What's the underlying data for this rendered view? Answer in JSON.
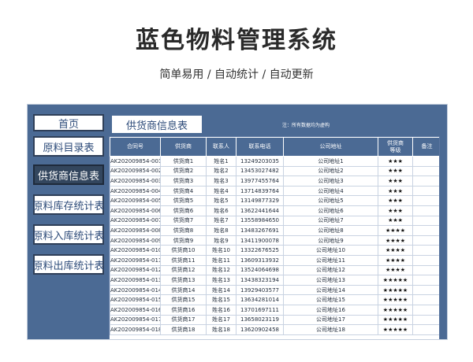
{
  "title": "蓝色物料管理系统",
  "subtitle": "简单易用  /  自动统计  /  自动更新",
  "sidebar": {
    "items": [
      {
        "label": "首页"
      },
      {
        "label": "原料目录表"
      },
      {
        "label": "供货商信息表"
      },
      {
        "label": "原料库存统计表"
      },
      {
        "label": "原料入库统计表"
      },
      {
        "label": "原料出库统计表"
      }
    ]
  },
  "main": {
    "section_title": "供货商信息表",
    "note": "注：所有数据均为虚构",
    "columns": [
      "合同号",
      "供货商",
      "联系人",
      "联系电话",
      "公司地址",
      "供货商\n等级",
      "备注"
    ],
    "rows": [
      [
        "AK202009854-001",
        "供货商1",
        "姓名1",
        "13249203035",
        "公司地址1",
        "★★★",
        ""
      ],
      [
        "AK202009854-002",
        "供货商2",
        "姓名2",
        "13453027482",
        "公司地址2",
        "★★★",
        ""
      ],
      [
        "AK202009854-003",
        "供货商3",
        "姓名3",
        "13977455764",
        "公司地址3",
        "★★★",
        ""
      ],
      [
        "AK202009854-004",
        "供货商4",
        "姓名4",
        "13714839764",
        "公司地址4",
        "★★★",
        ""
      ],
      [
        "AK202009854-005",
        "供货商5",
        "姓名5",
        "13149877329",
        "公司地址5",
        "★★★",
        ""
      ],
      [
        "AK202009854-006",
        "供货商6",
        "姓名6",
        "13622441644",
        "公司地址6",
        "★★★",
        ""
      ],
      [
        "AK202009854-007",
        "供货商7",
        "姓名7",
        "13558984650",
        "公司地址7",
        "★★★",
        ""
      ],
      [
        "AK202009854-008",
        "供货商8",
        "姓名8",
        "13483267691",
        "公司地址8",
        "★★★★",
        ""
      ],
      [
        "AK202009854-009",
        "供货商9",
        "姓名9",
        "13411900078",
        "公司地址9",
        "★★★★",
        ""
      ],
      [
        "AK202009854-010",
        "供货商10",
        "姓名10",
        "13322676525",
        "公司地址10",
        "★★★★",
        ""
      ],
      [
        "AK202009854-011",
        "供货商11",
        "姓名11",
        "13609313932",
        "公司地址11",
        "★★★★",
        ""
      ],
      [
        "AK202009854-012",
        "供货商12",
        "姓名12",
        "13524064698",
        "公司地址12",
        "★★★★",
        ""
      ],
      [
        "AK202009854-013",
        "供货商13",
        "姓名13",
        "13438323194",
        "公司地址13",
        "★★★★★",
        ""
      ],
      [
        "AK202009854-014",
        "供货商14",
        "姓名14",
        "13929403577",
        "公司地址14",
        "★★★★★",
        ""
      ],
      [
        "AK202009854-015",
        "供货商15",
        "姓名15",
        "13634281014",
        "公司地址15",
        "★★★★★",
        ""
      ],
      [
        "AK202009854-016",
        "供货商16",
        "姓名16",
        "13701697111",
        "公司地址16",
        "★★★★★",
        ""
      ],
      [
        "AK202009854-017",
        "供货商17",
        "姓名17",
        "13658023119",
        "公司地址17",
        "★★★★★",
        ""
      ],
      [
        "AK202009854-018",
        "供货商18",
        "姓名18",
        "13620902458",
        "公司地址18",
        "★★★★★",
        ""
      ]
    ]
  },
  "colors": {
    "frame_blue": "#4b6a94",
    "active_nav": "#33465e",
    "text_blue": "#2e4c7a"
  }
}
